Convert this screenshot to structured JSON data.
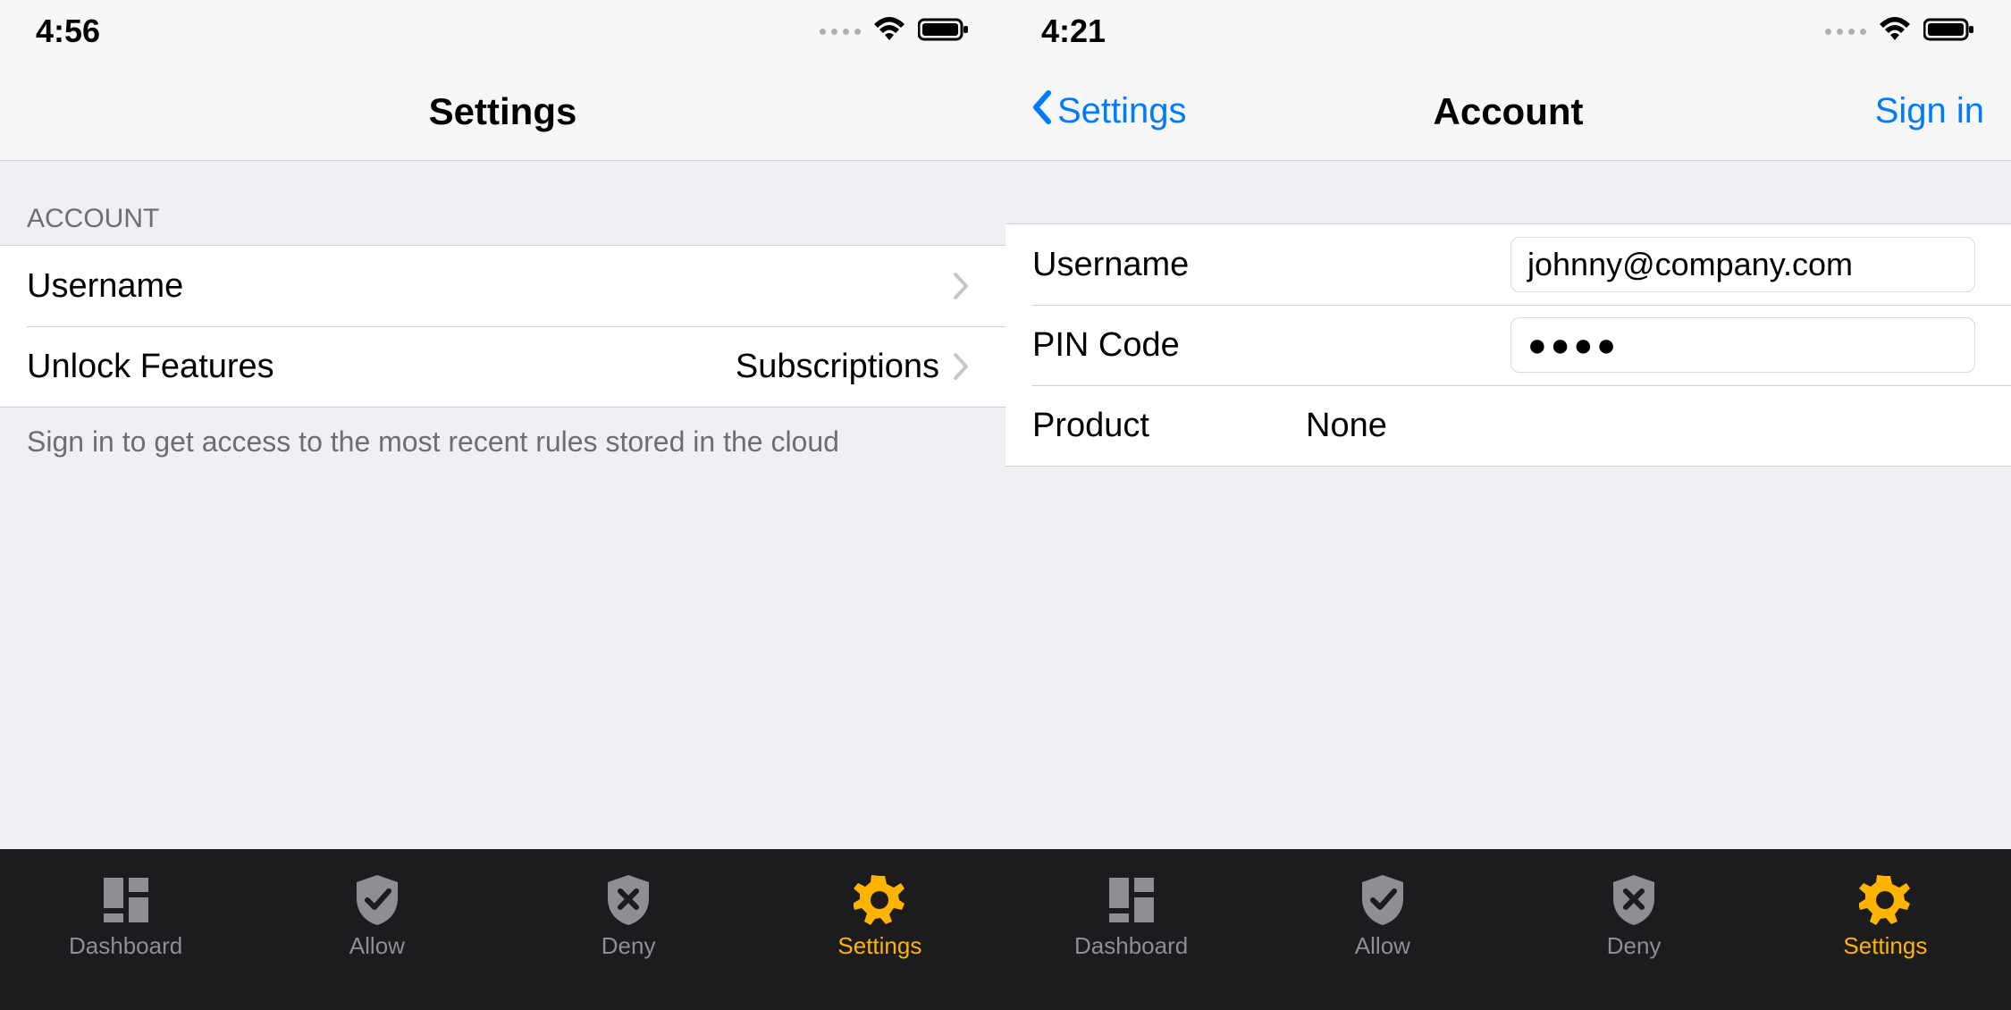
{
  "left": {
    "status_time": "4:56",
    "nav_title": "Settings",
    "section_account_header": "ACCOUNT",
    "row_username": "Username",
    "row_unlock": "Unlock Features",
    "row_unlock_value": "Subscriptions",
    "footer": "Sign in to get access to the most recent rules stored in the cloud"
  },
  "right": {
    "status_time": "4:21",
    "nav_back": "Settings",
    "nav_title": "Account",
    "nav_action": "Sign in",
    "row_username_label": "Username",
    "row_username_value": "johnny@company.com",
    "row_pin_label": "PIN Code",
    "row_pin_value": "●●●●",
    "row_product_label": "Product",
    "row_product_value": "None"
  },
  "tabs": {
    "dashboard": "Dashboard",
    "allow": "Allow",
    "deny": "Deny",
    "settings": "Settings"
  },
  "colors": {
    "tint": "#007aff",
    "accent": "#ffb400",
    "gray": "#8e8e93"
  }
}
